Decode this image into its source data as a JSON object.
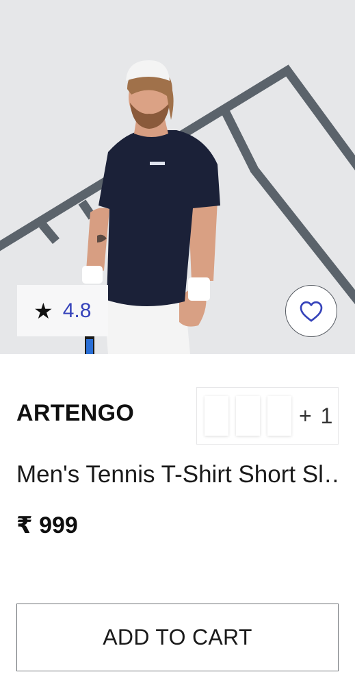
{
  "product": {
    "brand": "ARTENGO",
    "title": "Men's Tennis T-Shirt Short Sl…",
    "price": "₹ 999",
    "rating": "4.8",
    "rating_icon": "star-icon",
    "wishlist_icon": "heart-icon",
    "more_colors": "+ 1",
    "add_to_cart_label": "ADD TO CART",
    "image_logo_text": "ARTENGO"
  },
  "colors": {
    "rating_value": "#3643ba",
    "heart_stroke": "#3643ba",
    "shirt": "#1b2138",
    "background": "#e6e7e9"
  }
}
